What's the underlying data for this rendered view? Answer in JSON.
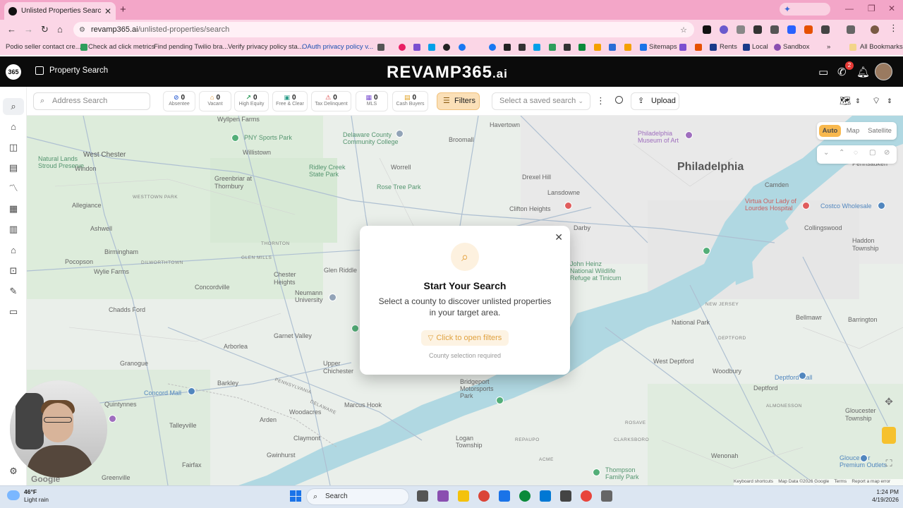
{
  "browser": {
    "tab_title": "Unlisted Properties Search - Un",
    "url_host": "revamp365.ai",
    "url_path": "/unlisted-properties/search",
    "bookmarks": [
      "Podio seller contact cre...",
      "Check ad click metrics",
      "Find pending Twilio bra...",
      "Verify privacy policy sta...",
      "OAuth privacy policy v...",
      "Sitemaps",
      "Rents",
      "Local",
      "Sandbox",
      "All Bookmarks"
    ]
  },
  "app": {
    "page_title": "Property Search",
    "brand": "REVAMP365",
    "brand_suffix": ".ai",
    "notification_count": "2"
  },
  "filterbar": {
    "address_placeholder": "Address Search",
    "chips": [
      {
        "count": "0",
        "label": "Absentee",
        "icon_color": "#3b6ad6"
      },
      {
        "count": "0",
        "label": "Vacant",
        "icon_color": "#e0922a"
      },
      {
        "count": "0",
        "label": "High Equity",
        "icon_color": "#2e9d5b"
      },
      {
        "count": "0",
        "label": "Free & Clear",
        "icon_color": "#2e9d8a"
      },
      {
        "count": "0",
        "label": "Tax Delinquent",
        "icon_color": "#d93a3a"
      },
      {
        "count": "0",
        "label": "MLS",
        "icon_color": "#7b4fd0"
      },
      {
        "count": "0",
        "label": "Cash Buyers",
        "icon_color": "#e0a020"
      }
    ],
    "filters_label": "Filters",
    "saved_search_placeholder": "Select a saved search",
    "upload_label": "Upload"
  },
  "map": {
    "type_options": [
      "Auto",
      "Map",
      "Satellite"
    ],
    "active_type": "Auto",
    "footer": {
      "shortcuts": "Keyboard shortcuts",
      "data": "Map Data ©2026 Google",
      "terms": "Terms",
      "report": "Report a map error"
    },
    "google": "Google",
    "places": [
      {
        "name": "Wyllpen Farms",
        "style": ""
      },
      {
        "name": "PNY Sports Park",
        "style": ""
      },
      {
        "name": "Willistown",
        "style": ""
      },
      {
        "name": "West Chester",
        "style": "med"
      },
      {
        "name": "Natural Lands Stroud Preserve",
        "style": "green"
      },
      {
        "name": "Windon",
        "style": ""
      },
      {
        "name": "WESTTOWN PARK",
        "style": "caps"
      },
      {
        "name": "Greenbriar at Thornbury",
        "style": ""
      },
      {
        "name": "Allegiance",
        "style": ""
      },
      {
        "name": "Ashwell",
        "style": ""
      },
      {
        "name": "Pocopson",
        "style": ""
      },
      {
        "name": "Birmingham",
        "style": ""
      },
      {
        "name": "Wylie Farms",
        "style": ""
      },
      {
        "name": "DILWORTHTOWN",
        "style": "caps"
      },
      {
        "name": "Concordville",
        "style": ""
      },
      {
        "name": "Chadds Ford",
        "style": ""
      },
      {
        "name": "Delaware County Community College",
        "style": "green"
      },
      {
        "name": "Ridley Creek State Park",
        "style": "green"
      },
      {
        "name": "Worrell",
        "style": ""
      },
      {
        "name": "Rose Tree Park",
        "style": "green"
      },
      {
        "name": "Havertown",
        "style": ""
      },
      {
        "name": "Broomall",
        "style": ""
      },
      {
        "name": "Drexel Hill",
        "style": ""
      },
      {
        "name": "Lansdowne",
        "style": ""
      },
      {
        "name": "Clifton Heights",
        "style": ""
      },
      {
        "name": "Darby",
        "style": ""
      },
      {
        "name": "Philadelphia Museum of Art",
        "style": "purple"
      },
      {
        "name": "Philadelphia",
        "style": "big"
      },
      {
        "name": "Camden",
        "style": ""
      },
      {
        "name": "Virtua Our Lady of Lourdes Hospital",
        "style": "red"
      },
      {
        "name": "Costco Wholesale",
        "style": "blue"
      },
      {
        "name": "Pennsauken",
        "style": ""
      },
      {
        "name": "Collingswood",
        "style": ""
      },
      {
        "name": "Haddon Township",
        "style": ""
      },
      {
        "name": "GLEN MILLS",
        "style": "caps"
      },
      {
        "name": "THORNTON",
        "style": "caps"
      },
      {
        "name": "Chester Heights",
        "style": ""
      },
      {
        "name": "Glen Riddle",
        "style": ""
      },
      {
        "name": "Neumann University",
        "style": ""
      },
      {
        "name": "John Heinz National Wildlife Refuge at Tinicum",
        "style": "green"
      },
      {
        "name": "Garnet Valley",
        "style": ""
      },
      {
        "name": "Arborlea",
        "style": ""
      },
      {
        "name": "Upper Chichester",
        "style": ""
      },
      {
        "name": "NEW JERSEY",
        "style": "caps"
      },
      {
        "name": "National Park",
        "style": ""
      },
      {
        "name": "Bellmawr",
        "style": ""
      },
      {
        "name": "Barrington",
        "style": ""
      },
      {
        "name": "West Deptford",
        "style": ""
      },
      {
        "name": "Woodbury",
        "style": ""
      },
      {
        "name": "Deptford Mall",
        "style": "blue"
      },
      {
        "name": "Deptford",
        "style": ""
      },
      {
        "name": "Granogue",
        "style": ""
      },
      {
        "name": "Barkley",
        "style": ""
      },
      {
        "name": "PENNSYLVANIA",
        "style": "caps"
      },
      {
        "name": "DELAWARE",
        "style": "caps"
      },
      {
        "name": "Concord Mall",
        "style": "blue"
      },
      {
        "name": "Quintynnes",
        "style": ""
      },
      {
        "name": "Woodacres",
        "style": ""
      },
      {
        "name": "Marcus Hook",
        "style": ""
      },
      {
        "name": "Bridgeport Motorsports Park",
        "style": ""
      },
      {
        "name": "Arden",
        "style": ""
      },
      {
        "name": "Talleyville",
        "style": ""
      },
      {
        "name": "Claymont",
        "style": ""
      },
      {
        "name": "Logan Township",
        "style": ""
      },
      {
        "name": "REPAUPO",
        "style": "caps"
      },
      {
        "name": "CLARKSBORO",
        "style": "caps"
      },
      {
        "name": "ALMONESSON",
        "style": "caps"
      },
      {
        "name": "Gloucester Township",
        "style": ""
      },
      {
        "name": "Gwinhurst",
        "style": ""
      },
      {
        "name": "Fairfax",
        "style": ""
      },
      {
        "name": "Greenville",
        "style": ""
      },
      {
        "name": "Wenonah",
        "style": ""
      },
      {
        "name": "Gloucester Premium Outlets",
        "style": "blue"
      },
      {
        "name": "Thompson Family Park",
        "style": "green"
      },
      {
        "name": "ROSAVE",
        "style": "caps"
      },
      {
        "name": "ACME",
        "style": "caps"
      },
      {
        "name": "DEPTFORD",
        "style": "caps"
      }
    ]
  },
  "modal": {
    "title": "Start Your Search",
    "description": "Select a county to discover unlisted properties in your target area.",
    "cta": "Click to open filters",
    "note": "County selection required"
  },
  "taskbar": {
    "temp": "46°F",
    "weather": "Light rain",
    "search": "Search",
    "time": "1:24 PM",
    "date": "4/19/2026"
  }
}
